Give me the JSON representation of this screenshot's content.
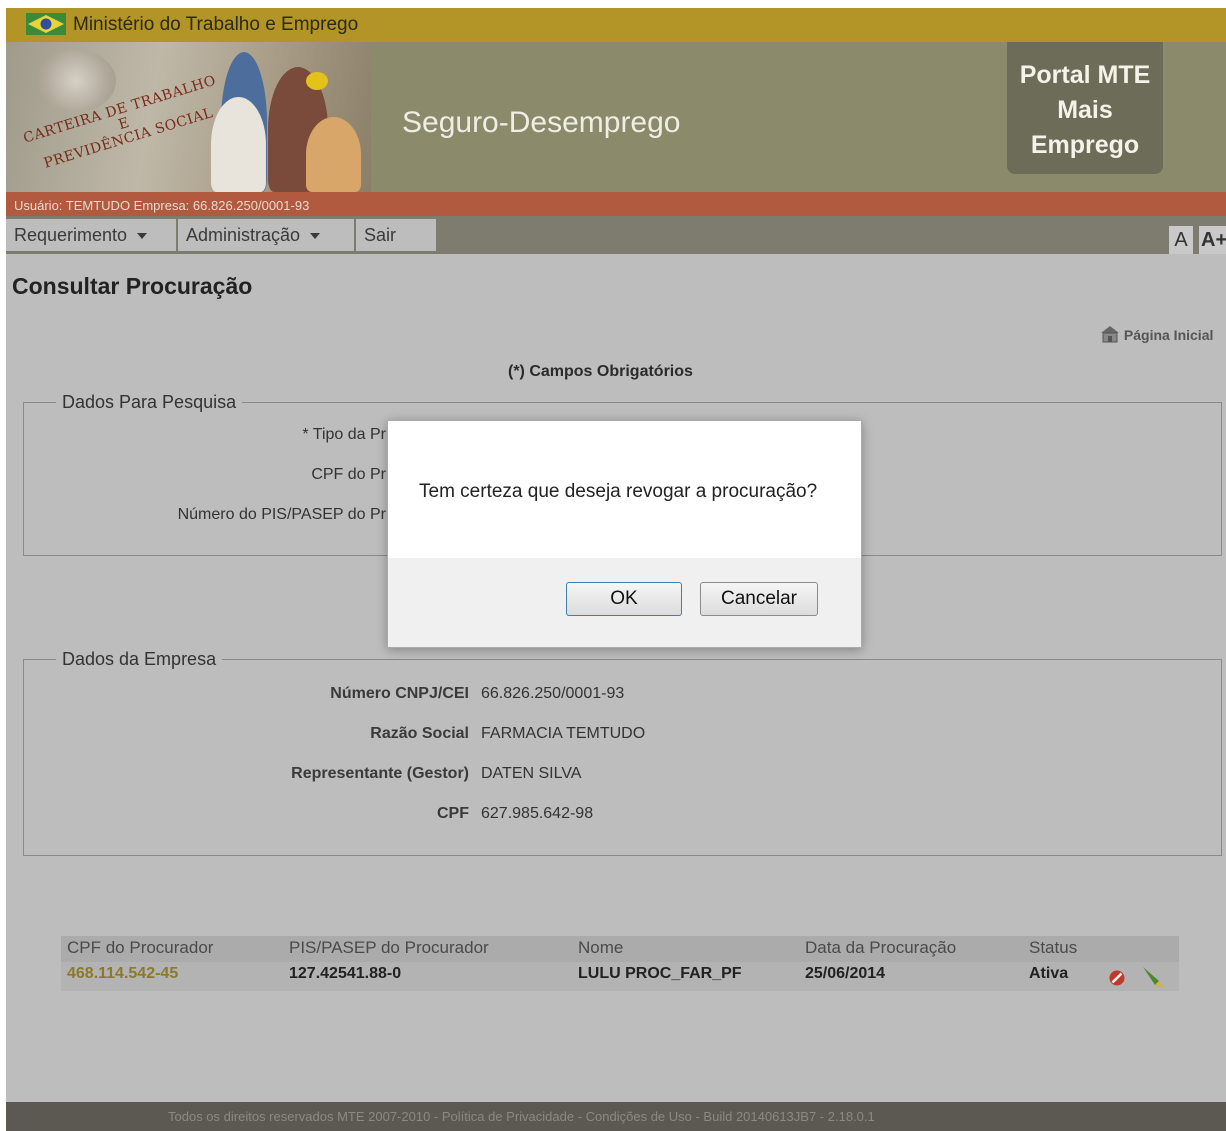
{
  "header": {
    "ministry": "Ministério do Trabalho e Emprego",
    "card_text": "CARTEIRA DE TRABALHO E PREVIDÊNCIA SOCIAL",
    "system": "Seguro-Desemprego",
    "portal": [
      "Portal MTE",
      "Mais",
      "Emprego"
    ]
  },
  "user_bar": "Usuário: TEMTUDO Empresa: 66.826.250/0001-93",
  "menu": {
    "items": [
      {
        "label": "Requerimento",
        "has_dropdown": true
      },
      {
        "label": "Administração",
        "has_dropdown": true
      },
      {
        "label": "Sair",
        "has_dropdown": false
      }
    ],
    "font_small": "A",
    "font_large": "A+"
  },
  "page": {
    "title": "Consultar Procuração",
    "home_link": "Página Inicial",
    "required_note": "(*) Campos Obrigatórios"
  },
  "search": {
    "legend": "Dados Para Pesquisa",
    "fields": [
      {
        "label": "* Tipo da Pr"
      },
      {
        "label": "CPF do Pr"
      },
      {
        "label": "Número do PIS/PASEP do Pr"
      }
    ]
  },
  "company": {
    "legend": "Dados da Empresa",
    "fields": [
      {
        "label": "Número CNPJ/CEI",
        "value": "66.826.250/0001-93"
      },
      {
        "label": "Razão Social",
        "value": "FARMACIA TEMTUDO"
      },
      {
        "label": "Representante (Gestor)",
        "value": "DATEN SILVA"
      },
      {
        "label": "CPF",
        "value": "627.985.642-98"
      }
    ]
  },
  "table": {
    "headers": [
      "CPF do Procurador",
      "PIS/PASEP do Procurador",
      "Nome",
      "Data da Procuração",
      "Status"
    ],
    "rows": [
      {
        "cpf": "468.114.542-45",
        "pis": "127.42541.88-0",
        "nome": "LULU PROC_FAR_PF",
        "data": "25/06/2014",
        "status": "Ativa"
      }
    ]
  },
  "footer": "Todos os direitos reservados MTE 2007-2010 - Política de Privacidade - Condições de Uso - Build 20140613JB7 - 2.18.0.1",
  "dialog": {
    "message": "Tem certeza que deseja revogar a procuração?",
    "ok": "OK",
    "cancel": "Cancelar"
  },
  "colors": {
    "topbar": "#b39427",
    "banner": "#8b8a6a",
    "user_bar": "#b25a40",
    "link_cpf": "#8a7a2a"
  }
}
